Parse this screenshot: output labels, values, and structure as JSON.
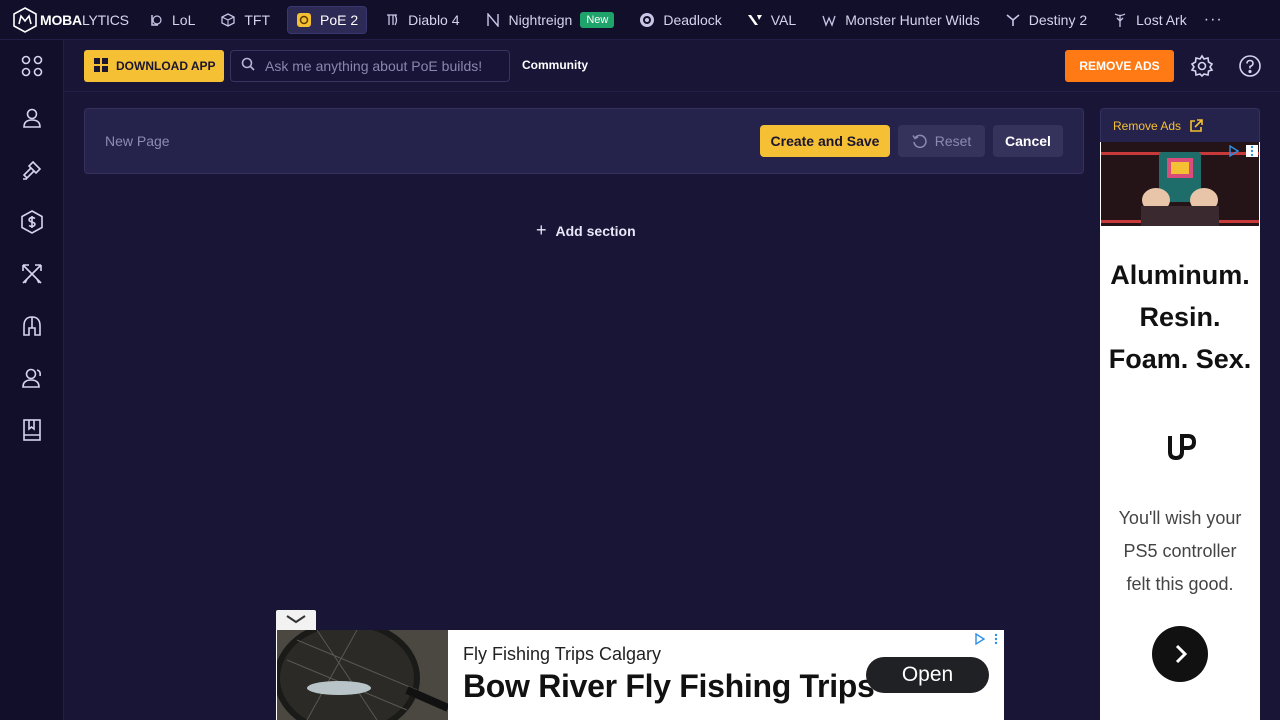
{
  "brand": {
    "bold": "MOBA",
    "light": "LYTICS"
  },
  "nav": {
    "games": [
      {
        "label": "LoL",
        "icon": "lol-icon"
      },
      {
        "label": "TFT",
        "icon": "tft-icon"
      },
      {
        "label": "PoE 2",
        "icon": "poe2-icon",
        "active": true
      },
      {
        "label": "Diablo 4",
        "icon": "diablo-icon"
      },
      {
        "label": "Nightreign",
        "icon": "nightreign-icon",
        "badge": "New"
      },
      {
        "label": "Deadlock",
        "icon": "deadlock-icon"
      },
      {
        "label": "VAL",
        "icon": "valorant-icon"
      },
      {
        "label": "Monster Hunter Wilds",
        "icon": "monster-hunter-icon"
      },
      {
        "label": "Destiny 2",
        "icon": "destiny-icon"
      },
      {
        "label": "Lost Ark",
        "icon": "lost-ark-icon"
      }
    ],
    "more": "···"
  },
  "toolbar": {
    "download_label": "DOWNLOAD APP",
    "search_placeholder": "Ask me anything about PoE builds!",
    "community_label": "Community",
    "remove_ads_label": "REMOVE ADS"
  },
  "editor": {
    "page_name_placeholder": "New Page",
    "create_label": "Create and Save",
    "reset_label": "Reset",
    "cancel_label": "Cancel",
    "add_section_label": "Add section"
  },
  "side_ad": {
    "remove_ads_link": "Remove Ads",
    "headline_lines": [
      "Aluminum.",
      "Resin.",
      "Foam. Sex."
    ],
    "copy": "You'll wish your PS5 controller felt this good."
  },
  "bottom_ad": {
    "subtitle": "Fly Fishing Trips Calgary",
    "title": "Bow River Fly Fishing Trips",
    "cta": "Open"
  },
  "colors": {
    "background": "#181536",
    "nav_background": "#120f2b",
    "accent_yellow": "#f5c033",
    "accent_orange": "#ff7a14",
    "badge_green": "#1ea36a"
  }
}
